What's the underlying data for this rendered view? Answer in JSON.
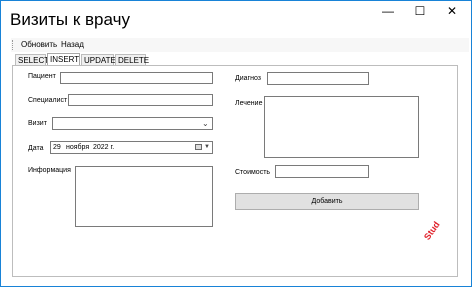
{
  "window": {
    "title": "Визиты к врачу",
    "controls": {
      "minimize": "—",
      "maximize": "☐",
      "close": "✕"
    }
  },
  "menu": {
    "items": [
      "Обновить",
      "Назад"
    ]
  },
  "tabs": [
    {
      "label": "SELECT",
      "active": false
    },
    {
      "label": "INSERT",
      "active": true
    },
    {
      "label": "UPDATE",
      "active": false
    },
    {
      "label": "DELETE",
      "active": false
    }
  ],
  "form": {
    "patient_label": "Пациент",
    "patient_value": "",
    "specialist_label": "Специалист",
    "specialist_value": "",
    "visit_label": "Визит",
    "visit_value": "",
    "date_label": "Дата",
    "date_day": "29",
    "date_month": "ноября",
    "date_year": "2022 г.",
    "info_label": "Информация",
    "info_value": "",
    "diagnosis_label": "Диагноз",
    "diagnosis_value": "",
    "treatment_label": "Лечение",
    "treatment_value": "",
    "cost_label": "Стоимость",
    "cost_value": "",
    "add_button": "Добавить"
  },
  "watermark": "Stud"
}
